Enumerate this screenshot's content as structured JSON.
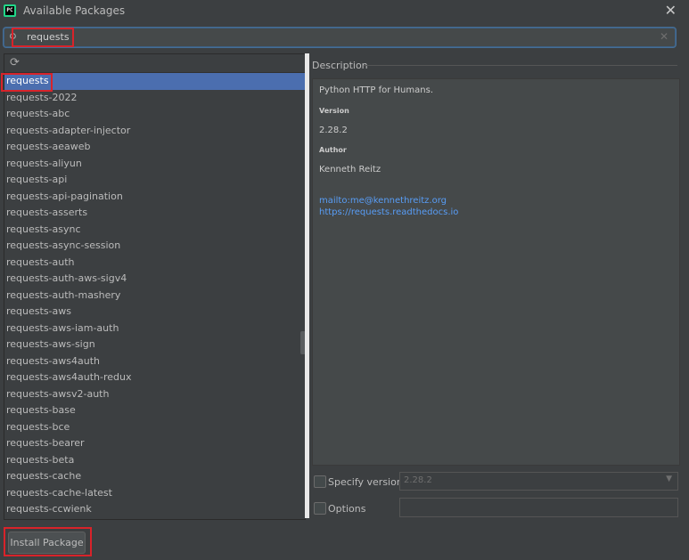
{
  "window": {
    "title": "Available Packages"
  },
  "search": {
    "query": "requests"
  },
  "packages": [
    "requests",
    "requests-2022",
    "requests-abc",
    "requests-adapter-injector",
    "requests-aeaweb",
    "requests-aliyun",
    "requests-api",
    "requests-api-pagination",
    "requests-asserts",
    "requests-async",
    "requests-async-session",
    "requests-auth",
    "requests-auth-aws-sigv4",
    "requests-auth-mashery",
    "requests-aws",
    "requests-aws-iam-auth",
    "requests-aws-sign",
    "requests-aws4auth",
    "requests-aws4auth-redux",
    "requests-awsv2-auth",
    "requests-base",
    "requests-bce",
    "requests-bearer",
    "requests-beta",
    "requests-cache",
    "requests-cache-latest",
    "requests-ccwienk"
  ],
  "selected_index": 0,
  "description": {
    "header": "Description",
    "summary": "Python HTTP for Humans.",
    "version_label": "Version",
    "version": "2.28.2",
    "author_label": "Author",
    "author": "Kenneth Reitz",
    "link_mail": "mailto:me@kennethreitz.org",
    "link_docs": "https://requests.readthedocs.io"
  },
  "options": {
    "specify_version_label": "Specify version",
    "specify_version_value": "2.28.2",
    "options_label": "Options"
  },
  "install_button": "Install Package",
  "colors": {
    "highlight": "#d8232a",
    "selection": "#4b6eaf",
    "link": "#589df6"
  }
}
